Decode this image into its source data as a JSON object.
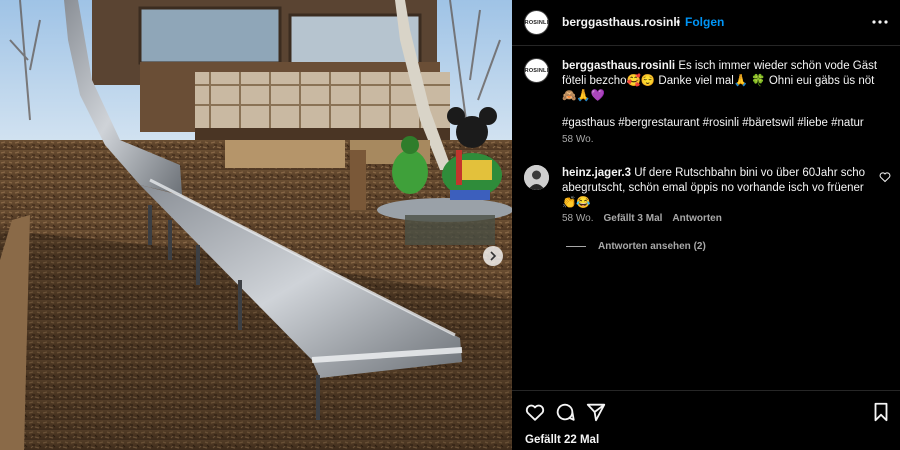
{
  "post": {
    "account": "berggasthaus.rosinli",
    "follow_label": "Folgen",
    "separator": "•",
    "avatar_logo": "ROSINLI"
  },
  "caption": {
    "username": "berggasthaus.rosinli",
    "text": "Es isch immer wieder schön vode Gäst föteli bezcho🥰😌 Danke viel mal🙏 🍀 Ohni eui gäbs üs nöt 🙈🙏💜",
    "hashtags": "#gasthaus #bergrestaurant #rosinli #bäretswil #liebe #natur",
    "time": "58 Wo."
  },
  "comment": {
    "username": "heinz.jager.3",
    "text": "Uf dere Rutschbahn bini vo über 60Jahr scho abegrutscht, schön emal öppis no vorhande isch vo früener 👏😂",
    "time": "58 Wo.",
    "likes": "Gefällt 3 Mal",
    "reply_label": "Antworten",
    "view_replies": "Antworten ansehen (2)"
  },
  "footer": {
    "likes": "Gefällt 22 Mal"
  },
  "icons": {
    "more": "more-options-icon",
    "heart": "heart-icon",
    "comment": "comment-icon",
    "share": "share-icon",
    "save": "bookmark-icon",
    "next": "chevron-right-icon"
  },
  "colors": {
    "background": "#000000",
    "text": "#f5f5f5",
    "secondary": "#a8a8a8",
    "link": "#0095f6",
    "divider": "#262626"
  }
}
